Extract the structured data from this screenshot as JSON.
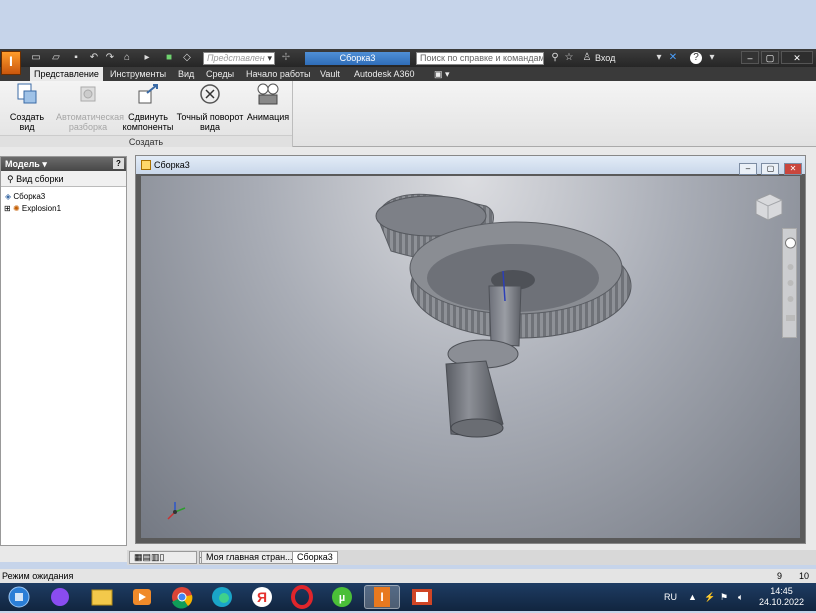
{
  "titlebar": {
    "view_rep_placeholder": "Представлен",
    "document_title": "Сборка3",
    "search_placeholder": "Поиск по справке и командам",
    "login_label": "Вход"
  },
  "ribbon_tabs": [
    "Представление",
    "Инструменты",
    "Вид",
    "Среды",
    "Начало работы",
    "Vault",
    "Autodesk A360"
  ],
  "ribbon": {
    "create_view": "Создать вид",
    "auto_explode_1": "Автоматическая",
    "auto_explode_2": "разборка",
    "tweak_1": "Сдвинуть",
    "tweak_2": "компоненты",
    "precise_rotate_1": "Точный поворот",
    "precise_rotate_2": "вида",
    "animation": "Анимация",
    "panel_label": "Создать"
  },
  "browser": {
    "header": "Модель",
    "view_label": "Вид сборки",
    "root_item": "Сборка3",
    "child_item": "Explosion1"
  },
  "mdi": {
    "title": "Сборка3"
  },
  "doc_tabs": [
    "Моя главная стран...",
    "Сборка3"
  ],
  "status": {
    "text": "Режим ожидания",
    "num1": "9",
    "num2": "10"
  },
  "taskbar": {
    "lang": "RU",
    "time": "14:45",
    "date": "24.10.2022"
  },
  "colors": {
    "accent": "#2f6db8",
    "ribbon_bg": "#e9e9e9",
    "titlebar": "#2e2e2e",
    "taskbar": "#163152"
  }
}
